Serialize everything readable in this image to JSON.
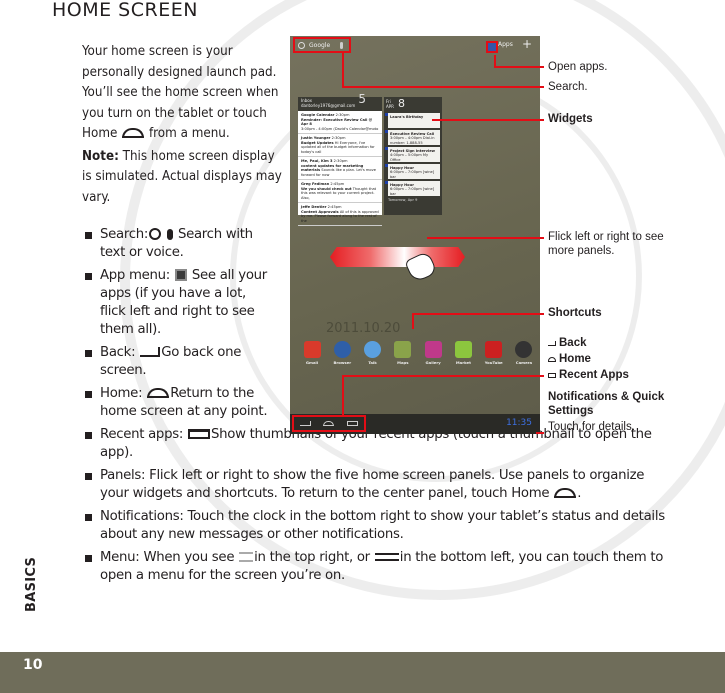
{
  "page": {
    "title": "HOME SCREEN",
    "section_label": "BASICS",
    "page_number": "10"
  },
  "intro": {
    "paragraph": "Your home screen is your personally designed launch pad. You’ll see the home screen when you turn on the tablet or touch Home",
    "paragraph_end": "from a menu.",
    "note_label": "Note:",
    "note_text": "This home screen display is simulated. Actual displays may vary."
  },
  "bullets": [
    {
      "label": "Search:",
      "text": "Search with text or voice."
    },
    {
      "label": "App menu:",
      "text": "See all your apps (if you have a lot, flick left and right to see them all)."
    },
    {
      "label": "Back:",
      "text": "Go back one screen."
    },
    {
      "label": "Home:",
      "text": "Return to the home screen at any point."
    },
    {
      "label": "Recent apps:",
      "text": "Show thumbnails of your recent apps (touch a thumbnail to open the app)."
    },
    {
      "label": "Panels:",
      "text": "Flick left or right to show the five home screen panels. Use panels to organize your widgets and shortcuts. To return to the center panel, touch Home",
      "text_end": "."
    },
    {
      "label": "Notifications:",
      "text": "Touch the clock in the bottom right to show your tablet’s status and details about any new messages or other notifications."
    },
    {
      "label": "Menu:",
      "text_a": "When you see",
      "text_b": "in the top right, or",
      "text_c": "in the bottom left, you can touch them to open a menu for the screen you’re on."
    }
  ],
  "tablet": {
    "search_label": "Google",
    "apps_label": "Apps",
    "plus_label": "+",
    "mail_widget": {
      "title": "Inbox",
      "account": "dantorley1976@gmail.com",
      "count": "5",
      "items": [
        {
          "from": "Google Calendar",
          "time": "2:30pm",
          "subject": "Reminder: Executive Review Call @ Apr 8",
          "preview": "3:00pm - 4:00pm (David's Calendar@moto"
        },
        {
          "from": "Justin Younger",
          "time": "2:30pm",
          "subject": "Budget Updates",
          "preview": "Hi Everyone, I've updated all of the budget information for today's call"
        },
        {
          "from": "Me, Paul, Kim 3",
          "time": "2:30pm",
          "subject": "content updates for marketing materials",
          "preview": "Sounds like a plan. Let's move forward for now"
        },
        {
          "from": "Greg Fedlman",
          "time": "2:45pm",
          "subject": "We you should check out",
          "preview": "Thought that this was relevant to your current project. Also,"
        },
        {
          "from": "Jeffe Dentler",
          "time": "2:45pm",
          "subject": "Content Approvals",
          "preview": "All of this is approved by me. Please forward along to the rest of the"
        }
      ]
    },
    "calendar_widget": {
      "day": "Fri",
      "month": "APR",
      "date": "8",
      "events": [
        {
          "title": "Laura's Birthday",
          "detail": ""
        },
        {
          "title": "Executive Review Call",
          "detail": "3:00pm – 4:00pm Dial-in number: 1-888-55"
        },
        {
          "title": "Project Sign Interview",
          "detail": "4:00pm – 5:00pm My Office"
        },
        {
          "title": "Happy Hour",
          "detail": "6:00pm – 7:00pm [wine] bar"
        },
        {
          "title": "Happy Hour",
          "detail": "6:00pm – 7:00pm [wine] bar"
        }
      ],
      "footer": "Tomorrow, Apr 9"
    },
    "date_stamp": "2011.10.20",
    "dock": [
      {
        "label": "Gmail",
        "icon": "gmail-icon",
        "color": "#d93a2b"
      },
      {
        "label": "Browser",
        "icon": "browser-icon",
        "color": "#2f5fa8"
      },
      {
        "label": "Talk",
        "icon": "talk-icon",
        "color": "#5aa0e0"
      },
      {
        "label": "Maps",
        "icon": "maps-icon",
        "color": "#8aa34a"
      },
      {
        "label": "Gallery",
        "icon": "gallery-icon",
        "color": "#c0398a"
      },
      {
        "label": "Market",
        "icon": "market-icon",
        "color": "#8cc63e"
      },
      {
        "label": "YouTube",
        "icon": "youtube-icon",
        "color": "#cc2020"
      },
      {
        "label": "Camera",
        "icon": "camera-icon",
        "color": "#333333"
      }
    ],
    "clock": "11:35"
  },
  "annotations": {
    "open_apps": "Open apps.",
    "search": "Search.",
    "widgets": "Widgets",
    "flick": "Flick left or right to see more panels.",
    "shortcuts": "Shortcuts",
    "back": "Back",
    "home": "Home",
    "recent_apps": "Recent Apps",
    "notifications_title": "Notifications & Quick Settings",
    "notifications_text": "Touch for details."
  },
  "colors": {
    "callout_red": "#e30d16",
    "tablet_bg": "#6a6855",
    "footer_bg": "#6f6d5a",
    "clock_blue": "#3d6fe0"
  }
}
